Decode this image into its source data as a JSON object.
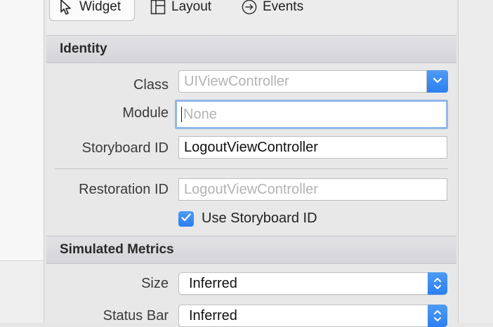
{
  "toolbar": {
    "widget_label": "Widget",
    "layout_label": "Layout",
    "events_label": "Events"
  },
  "identity": {
    "header": "Identity",
    "class_label": "Class",
    "class_placeholder": "UIViewController",
    "module_label": "Module",
    "module_placeholder": "None",
    "storyboard_id_label": "Storyboard ID",
    "storyboard_id_value": "LogoutViewController",
    "restoration_id_label": "Restoration ID",
    "restoration_id_placeholder": "LogoutViewController",
    "use_storyboard_id_label": "Use Storyboard ID",
    "use_storyboard_id_checked": true
  },
  "simulated_metrics": {
    "header": "Simulated Metrics",
    "size_label": "Size",
    "size_value": "Inferred",
    "status_bar_label": "Status Bar",
    "status_bar_value": "Inferred"
  },
  "colors": {
    "accent": "#2c7ff0",
    "focus_ring": "#8fb8e8"
  }
}
